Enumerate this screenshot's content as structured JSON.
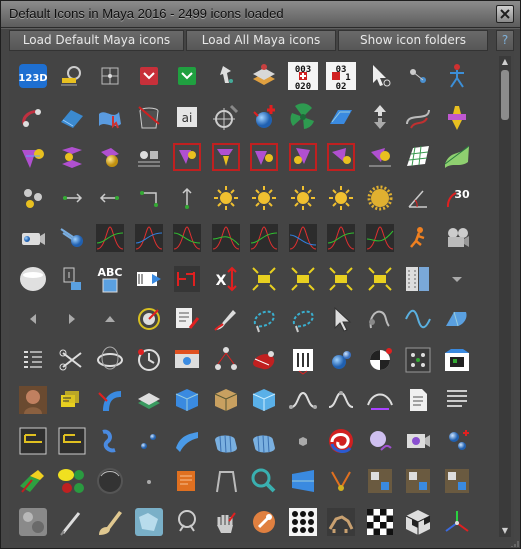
{
  "window": {
    "title": "Default Icons in Maya 2016 - 2499 icons loaded"
  },
  "toolbar": {
    "buttons": [
      {
        "label": "Load Default Maya icons"
      },
      {
        "label": "Load All Maya icons"
      },
      {
        "label": "Show icon folders"
      }
    ],
    "help_label": "?"
  },
  "icon_labels": {
    "r0c0": "123D",
    "r1c4": "ai",
    "r6c2": "ABC",
    "r0c7a": "003",
    "r0c7b": "020",
    "r0c8a": "03",
    "r0c8b": "1",
    "r0c8c": "02",
    "r4c11": "30",
    "r5c6": "X"
  },
  "icons": [
    "123d-logo-icon",
    "rename-tool-icon",
    "snap-grid-icon",
    "reveal-red-icon",
    "reveal-green-icon",
    "pin-vertex-icon",
    "layer-stack-icon",
    "counter-plus-icon",
    "counter-plus-icon-2",
    "select-move-icon",
    "bead-icon",
    "skeleton-joint-icon",
    "constraint-link-icon",
    "surface-edit-icon",
    "cloth-cursor-icon",
    "delete-bin-icon",
    "adobe-illustrator-icon",
    "target-crosshair-icon",
    "sphere-add-icon",
    "fan-shape-icon",
    "blue-plane-icon",
    "up-down-arrows-icon",
    "curve-project-icon",
    "magnet-cone-icon",
    "blend-shape-icon",
    "cluster-icon",
    "cluster-sphere-icon",
    "ground-plane-icon",
    "deformer-red-icon",
    "deformer-red-icon-2",
    "deformer-red-icon-3",
    "deformer-red-icon-4",
    "deformer-red-icon-5",
    "deformer-plain-icon",
    "grid-surface-icon",
    "grid-surface-icon-2",
    "molecule-icon",
    "move-vertex-icon",
    "move-vertex-icon-2",
    "move-vertex-icon-3",
    "move-vertex-icon-4",
    "light-bulb-icon",
    "light-bulb-icon-2",
    "light-bulb-icon-3",
    "light-bulb-icon-4",
    "spin-saw-icon",
    "angle-axis-icon",
    "rotate-30-icon",
    "camera-icon",
    "comet-icon",
    "graph-curve-icon",
    "graph-curve-icon-2",
    "graph-curve-icon-3",
    "graph-curve-icon-4",
    "graph-curve-icon-5",
    "graph-curve-icon-6",
    "graph-curve-icon-7",
    "graph-curve-icon-8",
    "running-man-icon",
    "film-camera-icon",
    "shelf-disc-icon",
    "attribute-editor-icon",
    "text-tool-icon",
    "media-play-icon",
    "key-pattern-icon",
    "scale-x-icon",
    "expand-box-icon",
    "expand-box-icon-2",
    "expand-box-icon-3",
    "expand-box-icon-4",
    "film-strip-icon",
    "dropdown-arrow-icon",
    "arrow-left-icon",
    "arrow-right-icon",
    "arrow-up-icon",
    "target-ring-icon",
    "editor-edit-icon",
    "paint-brush-icon",
    "lasso-dotted-icon",
    "lasso-dotted-icon-2",
    "cursor-arrow-icon",
    "wrap-curve-icon",
    "sine-wave-icon",
    "plane-bend-icon",
    "outliner-list-icon",
    "scissors-cut-icon",
    "torus-rings-icon",
    "clock-timer-icon",
    "render-view-icon",
    "node-tree-icon",
    "muscle-red-icon",
    "film-clip-icon",
    "sphere-cluster-icon",
    "checker-ball-icon",
    "dots-grid-icon",
    "checker-shirt-icon",
    "avatar-head-icon",
    "keyframes-icon",
    "bend-deform-icon",
    "uv-layers-icon",
    "cube-blue-icon",
    "cube-shade-icon",
    "cube-light-icon",
    "curve-peak-icon",
    "curve-peak-icon-2",
    "curve-peak-icon-3",
    "document-icon",
    "document-lines-icon",
    "frame-select-icon",
    "frame-select-icon-2",
    "chain-link-icon",
    "dot-pair-icon",
    "surface-wave-icon",
    "cylinder-lofted-icon",
    "cylinder-lofted-icon-2",
    "small-cube-icon",
    "swirl-red-icon",
    "soft-body-icon",
    "camera-rig-icon",
    "dots-add-icon",
    "hair-volume-icon",
    "color-swatch-icon",
    "sphere-gray-icon",
    "dot-small-icon",
    "orange-note-icon",
    "path-shape-icon",
    "flare-search-icon",
    "cone-tilt-icon",
    "v-shape-icon",
    "pixel-tile-icon",
    "pixel-tile-icon-2",
    "pixel-tile-icon-3",
    "noise-texture-icon",
    "pencil-line-icon",
    "paint-brush-big-icon",
    "ice-texture-icon",
    "hair-gear-icon",
    "hand-tool-icon",
    "wrench-round-icon",
    "dot-matrix-icon",
    "photo-animal-icon",
    "checker-square-icon",
    "checker-cube-icon",
    "axis-xyz-icon"
  ]
}
